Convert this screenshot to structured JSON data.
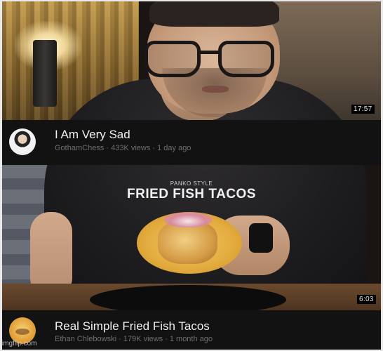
{
  "video_top": {
    "duration": "17:57",
    "title": "I Am Very Sad",
    "meta": "GothamChess · 433K views · 1 day ago"
  },
  "thumbnail_overlay": {
    "small_text": "PANKO STYLE",
    "big_text": "FRIED FISH TACOS"
  },
  "video_bottom": {
    "duration": "6:03",
    "title": "Real Simple Fried Fish Tacos",
    "meta": "Ethan Chlebowski · 179K views · 1 month ago"
  },
  "watermark": "imgflip.com"
}
